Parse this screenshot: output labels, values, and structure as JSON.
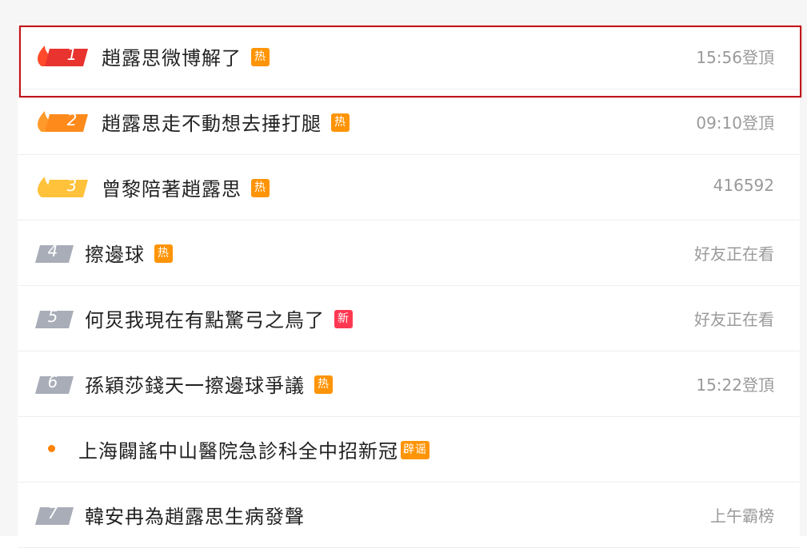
{
  "hot_search": {
    "items": [
      {
        "rank": "1",
        "title": "趙露思微博解了",
        "badge": "热",
        "badge_type": "hot",
        "meta": "15:56登頂",
        "flame": true,
        "rank_color": "#e8332e",
        "flame_color": "#ff4b2b"
      },
      {
        "rank": "2",
        "title": "趙露思走不動想去捶打腿",
        "badge": "热",
        "badge_type": "hot",
        "meta": "09:10登頂",
        "flame": true,
        "rank_color": "#ff8a1c",
        "flame_color": "#ff9a2a"
      },
      {
        "rank": "3",
        "title": "曾黎陪著趙露思",
        "badge": "热",
        "badge_type": "hot",
        "meta": "416592",
        "flame": true,
        "rank_color": "#ffc23a",
        "flame_color": "#ffc23a"
      },
      {
        "rank": "4",
        "title": "擦邊球",
        "badge": "热",
        "badge_type": "hot",
        "meta": "好友正在看",
        "flame": false,
        "rank_color": "#a8adb8"
      },
      {
        "rank": "5",
        "title": "何炅我現在有點驚弓之鳥了",
        "badge": "新",
        "badge_type": "new",
        "meta": "好友正在看",
        "flame": false,
        "rank_color": "#a8adb8"
      },
      {
        "rank": "6",
        "title": "孫穎莎錢天一擦邊球爭議",
        "badge": "热",
        "badge_type": "hot",
        "meta": "15:22登頂",
        "flame": false,
        "rank_color": "#a8adb8"
      },
      {
        "rank": "",
        "title": "上海闢謠中山醫院急診科全中招新冠",
        "badge": "辟谣",
        "badge_type": "rumor",
        "meta": "",
        "flame": false,
        "dot": true
      },
      {
        "rank": "7",
        "title": "韓安冉為趙露思生病發聲",
        "badge": "",
        "badge_type": "",
        "meta": "上午霸榜",
        "flame": false,
        "rank_color": "#a8adb8"
      }
    ]
  }
}
